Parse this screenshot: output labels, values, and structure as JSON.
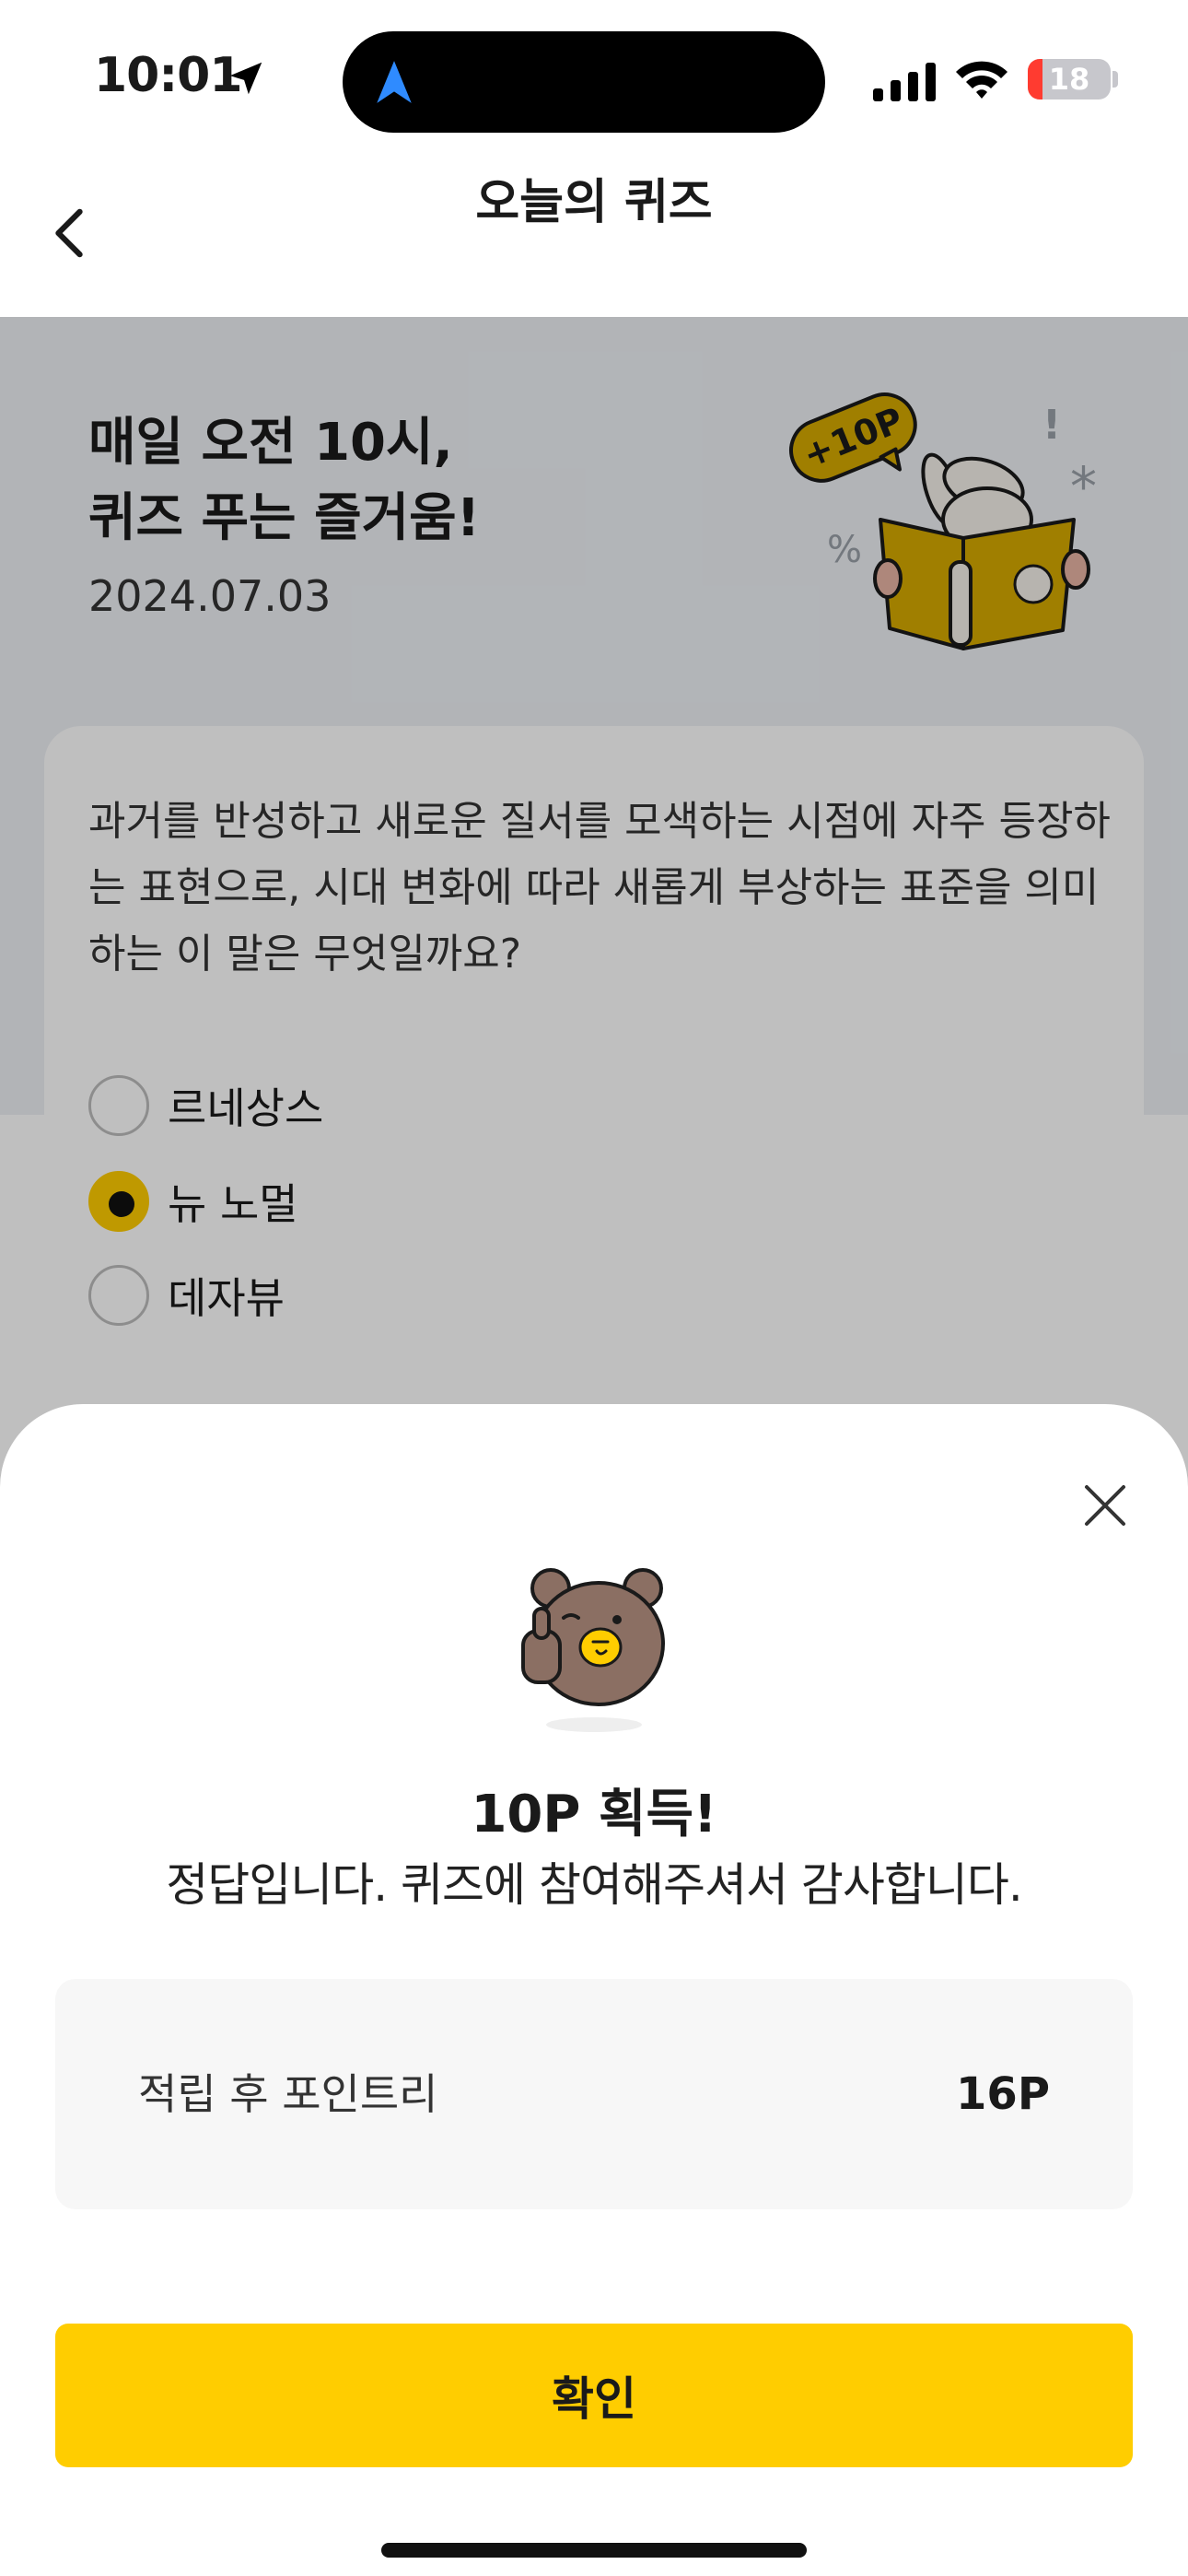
{
  "status_bar": {
    "time": "10:01",
    "battery": "18",
    "battery_level": 0.18
  },
  "header": {
    "title": "오늘의 퀴즈"
  },
  "hero": {
    "title": "매일 오전 10시,\n퀴즈 푸는 즐거움!",
    "date": "2024.07.03",
    "badge": "+10P"
  },
  "quiz": {
    "question": "과거를 반성하고 새로운 질서를 모색하는 시점에 자주 등장하는 표현으로, 시대 변화에 따라 새롭게 부상하는 표준을 의미하는 이 말은 무엇일까요?",
    "options": [
      {
        "label": "르네상스",
        "selected": false
      },
      {
        "label": "뉴 노멀",
        "selected": true
      },
      {
        "label": "데자뷰",
        "selected": false
      }
    ]
  },
  "result_sheet": {
    "title": "10P 획득!",
    "message": "정답입니다. 퀴즈에 참여해주셔서 감사합니다.",
    "points_label": "적립 후 포인트리",
    "points_value": "16P",
    "confirm_label": "확인"
  },
  "colors": {
    "accent": "#ffcd00",
    "dim_overlay": "rgba(0,0,0,0.25)"
  }
}
